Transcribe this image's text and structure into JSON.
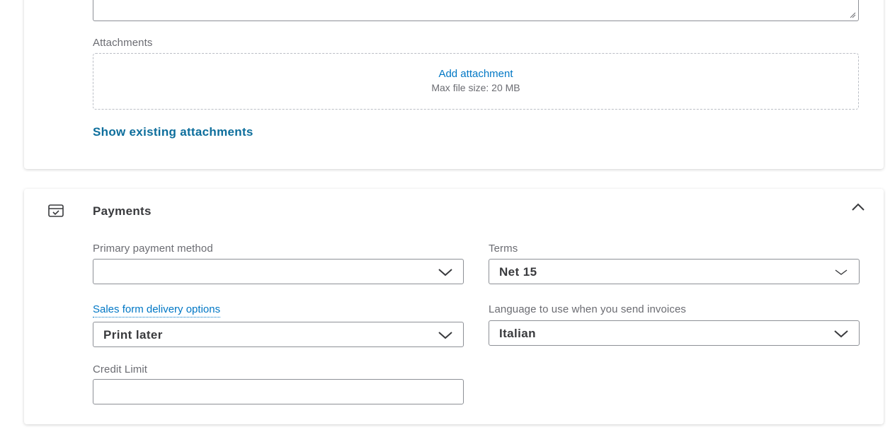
{
  "notes": {
    "resize_icon": "resize-grip-icon"
  },
  "attachments": {
    "label": "Attachments",
    "add_link": "Add attachment",
    "hint": "Max file size: 20 MB",
    "show_existing": "Show existing attachments"
  },
  "payments": {
    "title": "Payments",
    "section_icon": "payment-card-icon",
    "collapse_icon": "chevron-up-icon",
    "primary_method": {
      "label": "Primary payment method",
      "value": ""
    },
    "terms": {
      "label": "Terms",
      "value": "Net 15"
    },
    "delivery": {
      "label": "Sales form delivery options",
      "value": "Print later"
    },
    "language": {
      "label": "Language to use when you send invoices",
      "value": "Italian"
    },
    "credit_limit": {
      "label": "Credit Limit",
      "value": ""
    }
  },
  "colors": {
    "link": "#0077c5",
    "link_bold": "#0d6e9c",
    "text": "#393a3d",
    "label": "#6b6c72",
    "border": "#8d9096"
  }
}
